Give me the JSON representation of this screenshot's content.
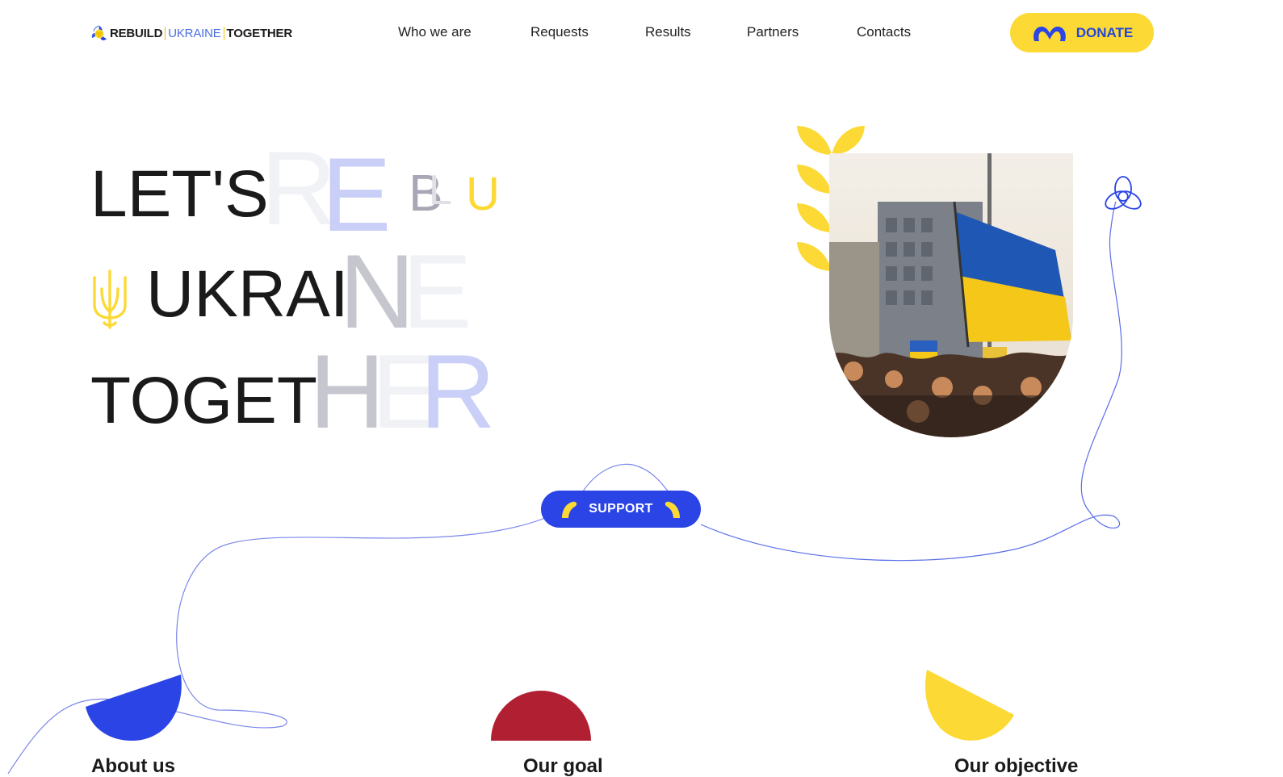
{
  "header": {
    "logo": {
      "word1": "REBUILD",
      "word2": "UKRAINE",
      "word3": "TOGETHER"
    },
    "nav": [
      {
        "label": "Who we are"
      },
      {
        "label": "Requests"
      },
      {
        "label": "Results"
      },
      {
        "label": "Partners"
      },
      {
        "label": "Contacts"
      }
    ],
    "donate_label": "DONATE"
  },
  "hero": {
    "line1_solid": "LET'S",
    "line2_solid": "UKRAI",
    "line3_solid": "TOGET",
    "ghost_letters": {
      "r": "R",
      "e": "E",
      "b": "B",
      "l": "L",
      "u": "U",
      "n": "N",
      "e2": "E",
      "h": "H",
      "e3": "E",
      "r2": "R"
    },
    "support_label": "SUPPORT"
  },
  "sections": [
    {
      "title": "About us",
      "shape_color": "#2a44e6"
    },
    {
      "title": "Our goal",
      "shape_color": "#b01f32"
    },
    {
      "title": "Our objective",
      "shape_color": "#fcd934"
    }
  ],
  "colors": {
    "brand_blue": "#2a44e6",
    "brand_yellow": "#fcd934",
    "accent_red": "#b01f32",
    "line_blue": "#5a6fe8"
  },
  "icons": {
    "logo": "rebuild-ukraine-logo-icon",
    "donate": "heart-hands-icon",
    "support_left": "hand-left-icon",
    "support_right": "hand-right-icon",
    "trident": "ukraine-trident-icon",
    "wheat": "wheat-ear-icon",
    "knot": "knot-icon"
  }
}
